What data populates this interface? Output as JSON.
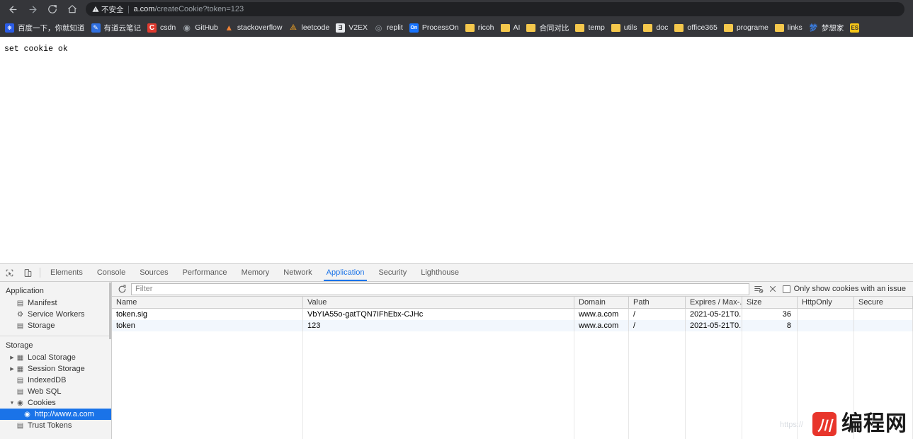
{
  "browser": {
    "nav": {
      "back": "back-arrow",
      "forward": "forward-arrow",
      "reload": "reload",
      "home": "home"
    },
    "omnibox": {
      "security_icon": "warning-triangle",
      "security_label": "不安全",
      "url_host": "a.com",
      "url_path": "/createCookie?token=123"
    },
    "bookmarks": [
      {
        "label": "百度一下，你就知道",
        "icon": "baidu-paw-icon",
        "icon_class": "ico-baidu",
        "glyph": "❋"
      },
      {
        "label": "有道云笔记",
        "icon": "youdao-note-icon",
        "icon_class": "ico-youdao",
        "glyph": "✎"
      },
      {
        "label": "csdn",
        "icon": "csdn-icon",
        "icon_class": "ico-csdn",
        "glyph": "C"
      },
      {
        "label": "GitHub",
        "icon": "github-icon",
        "icon_class": "ico-github",
        "glyph": "◉"
      },
      {
        "label": "stackoverflow",
        "icon": "stackoverflow-icon",
        "icon_class": "ico-so",
        "glyph": "▲"
      },
      {
        "label": "leetcode",
        "icon": "leetcode-icon",
        "icon_class": "ico-leet",
        "glyph": "⟁"
      },
      {
        "label": "V2EX",
        "icon": "v2ex-icon",
        "icon_class": "ico-v2ex",
        "glyph": "Ǝ"
      },
      {
        "label": "replit",
        "icon": "replit-icon",
        "icon_class": "ico-replit",
        "glyph": "◎"
      },
      {
        "label": "ProcessOn",
        "icon": "processon-icon",
        "icon_class": "ico-pon",
        "glyph": "On"
      },
      {
        "label": "ricoh",
        "icon": "folder-icon",
        "icon_class": "folder",
        "glyph": ""
      },
      {
        "label": "AI",
        "icon": "folder-icon",
        "icon_class": "folder",
        "glyph": ""
      },
      {
        "label": "合同对比",
        "icon": "folder-icon",
        "icon_class": "folder",
        "glyph": ""
      },
      {
        "label": "temp",
        "icon": "folder-icon",
        "icon_class": "folder",
        "glyph": ""
      },
      {
        "label": "utils",
        "icon": "folder-icon",
        "icon_class": "folder",
        "glyph": ""
      },
      {
        "label": "doc",
        "icon": "folder-icon",
        "icon_class": "folder",
        "glyph": ""
      },
      {
        "label": "office365",
        "icon": "folder-icon",
        "icon_class": "folder",
        "glyph": ""
      },
      {
        "label": "programe",
        "icon": "folder-icon",
        "icon_class": "folder",
        "glyph": ""
      },
      {
        "label": "links",
        "icon": "folder-icon",
        "icon_class": "folder",
        "glyph": ""
      },
      {
        "label": "梦想家",
        "icon": "mengxiangjia-icon",
        "icon_class": "ico-mx",
        "glyph": "梦"
      },
      {
        "label": "",
        "icon": "es-extension-icon",
        "icon_class": "ico-es",
        "glyph": "ES"
      }
    ]
  },
  "page": {
    "body_text": "set cookie ok"
  },
  "devtools": {
    "toolbar_icons": {
      "inspect": "inspect-element-icon",
      "device": "device-toolbar-icon"
    },
    "tabs": [
      {
        "label": "Elements",
        "active": false
      },
      {
        "label": "Console",
        "active": false
      },
      {
        "label": "Sources",
        "active": false
      },
      {
        "label": "Performance",
        "active": false
      },
      {
        "label": "Memory",
        "active": false
      },
      {
        "label": "Network",
        "active": false
      },
      {
        "label": "Application",
        "active": true
      },
      {
        "label": "Security",
        "active": false
      },
      {
        "label": "Lighthouse",
        "active": false
      }
    ],
    "sidebar": {
      "group_application": "Application",
      "application_items": [
        {
          "label": "Manifest",
          "icon": "manifest-file-icon",
          "glyph": "▤"
        },
        {
          "label": "Service Workers",
          "icon": "gear-icon",
          "glyph": "⚙"
        },
        {
          "label": "Storage",
          "icon": "database-icon",
          "glyph": "▤"
        }
      ],
      "group_storage": "Storage",
      "storage_items": [
        {
          "label": "Local Storage",
          "icon": "table-grid-icon",
          "glyph": "▦",
          "arrow": "▶",
          "indent": 1,
          "selected": false
        },
        {
          "label": "Session Storage",
          "icon": "table-grid-icon",
          "glyph": "▦",
          "arrow": "▶",
          "indent": 1,
          "selected": false
        },
        {
          "label": "IndexedDB",
          "icon": "database-icon",
          "glyph": "▤",
          "arrow": "",
          "indent": 1,
          "selected": false
        },
        {
          "label": "Web SQL",
          "icon": "database-icon",
          "glyph": "▤",
          "arrow": "",
          "indent": 1,
          "selected": false
        },
        {
          "label": "Cookies",
          "icon": "cookie-icon",
          "glyph": "◉",
          "arrow": "▼",
          "indent": 1,
          "selected": false
        },
        {
          "label": "http://www.a.com",
          "icon": "cookie-icon",
          "glyph": "◉",
          "arrow": "",
          "indent": 2,
          "selected": true
        },
        {
          "label": "Trust Tokens",
          "icon": "database-icon",
          "glyph": "▤",
          "arrow": "",
          "indent": 1,
          "selected": false
        }
      ]
    },
    "cookie_toolbar": {
      "refresh_icon": "refresh-icon",
      "filter_placeholder": "Filter",
      "filter_value": "",
      "clear_filter_icon": "clear-filter-icon",
      "delete_icon": "delete-x-icon",
      "issue_checkbox_label": "Only show cookies with an issue",
      "issue_checkbox_checked": false
    },
    "cookie_table": {
      "columns": [
        "Name",
        "Value",
        "Domain",
        "Path",
        "Expires / Max-...",
        "Size",
        "HttpOnly",
        "Secure"
      ],
      "rows": [
        {
          "name": "token.sig",
          "value": "VbYIA55o-gatTQN7IFhEbx-CJHc",
          "domain": "www.a.com",
          "path": "/",
          "expires": "2021-05-21T0...",
          "size": "36",
          "httponly": "",
          "secure": ""
        },
        {
          "name": "token",
          "value": "123",
          "domain": "www.a.com",
          "path": "/",
          "expires": "2021-05-21T0...",
          "size": "8",
          "httponly": "",
          "secure": ""
        }
      ]
    }
  },
  "watermark": {
    "mark": "川",
    "text": "编程网",
    "url": "https://"
  },
  "colors": {
    "chrome_bg": "#35363a",
    "omnibox_bg": "#202124",
    "accent_blue": "#1a73e8",
    "devtools_bg": "#f3f3f3",
    "row_alt": "#f2f7fd",
    "watermark_red": "#e8352b"
  }
}
